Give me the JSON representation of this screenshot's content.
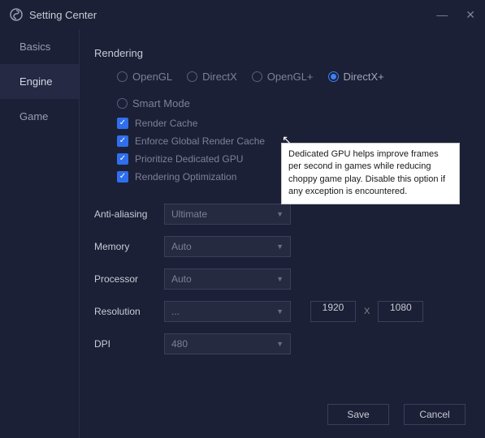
{
  "window": {
    "title": "Setting Center"
  },
  "sidebar": {
    "items": [
      {
        "label": "Basics"
      },
      {
        "label": "Engine"
      },
      {
        "label": "Game"
      }
    ]
  },
  "section": {
    "title": "Rendering"
  },
  "renderers": [
    {
      "label": "OpenGL"
    },
    {
      "label": "DirectX"
    },
    {
      "label": "OpenGL+"
    },
    {
      "label": "DirectX+"
    },
    {
      "label": "Smart Mode"
    }
  ],
  "checks": [
    {
      "label": "Render Cache"
    },
    {
      "label": "Enforce Global Render Cache"
    },
    {
      "label": "Prioritize Dedicated GPU"
    },
    {
      "label": "Rendering Optimization"
    }
  ],
  "tooltip": "Dedicated GPU helps improve frames per second in games while reducing choppy game play. Disable this option if any exception is encountered.",
  "form": {
    "aa_label": "Anti-aliasing",
    "aa_value": "Ultimate",
    "mem_label": "Memory",
    "mem_value": "Auto",
    "cpu_label": "Processor",
    "cpu_value": "Auto",
    "res_label": "Resolution",
    "res_value": "...",
    "res_w": "1920",
    "res_h": "1080",
    "x_sep": "X",
    "dpi_label": "DPI",
    "dpi_value": "480"
  },
  "footer": {
    "save": "Save",
    "cancel": "Cancel"
  }
}
